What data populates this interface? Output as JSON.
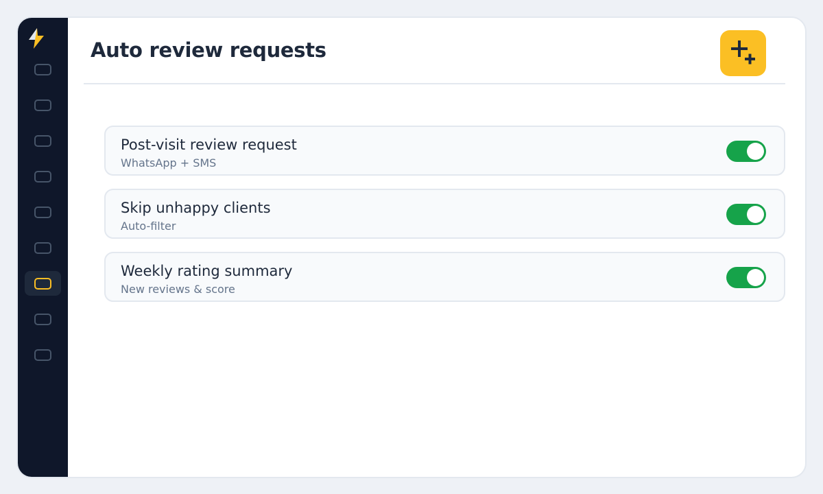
{
  "page": {
    "title": "Auto review requests"
  },
  "header": {
    "add_button_icon": "add-icon"
  },
  "sidebar": {
    "logo_icon": "lightning-bolt-icon",
    "active_index": 6,
    "items": [
      {
        "icon": "nav-icon"
      },
      {
        "icon": "nav-icon"
      },
      {
        "icon": "nav-icon"
      },
      {
        "icon": "nav-icon"
      },
      {
        "icon": "nav-icon"
      },
      {
        "icon": "nav-icon"
      },
      {
        "icon": "nav-icon"
      },
      {
        "icon": "nav-icon"
      },
      {
        "icon": "nav-icon"
      }
    ]
  },
  "settings": [
    {
      "title": "Post-visit review request",
      "subtitle": "WhatsApp + SMS",
      "enabled": true
    },
    {
      "title": "Skip unhappy clients",
      "subtitle": "Auto-filter",
      "enabled": true
    },
    {
      "title": "Weekly rating summary",
      "subtitle": "New reviews & score",
      "enabled": true
    }
  ],
  "colors": {
    "accent": "#fbbf24",
    "sidebar": "#0f172a",
    "toggle_on": "#16a34a",
    "text_primary": "#1e293b",
    "text_secondary": "#64748b"
  }
}
